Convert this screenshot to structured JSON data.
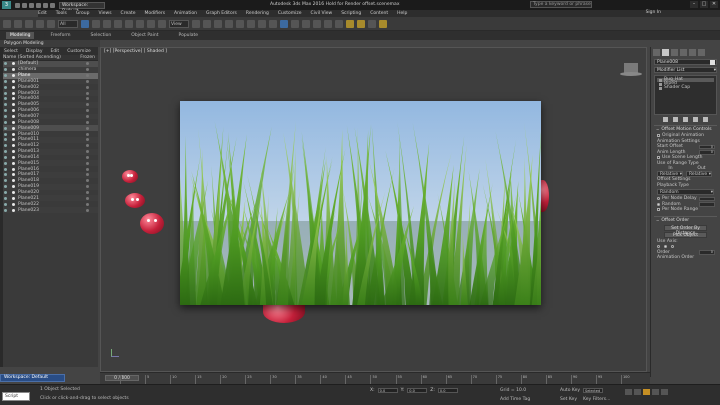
{
  "titlebar": {
    "workspace": "Workspace: Default",
    "title": "Autodesk 3ds Max 2016  Hold for Render  offset.scenemax",
    "search_placeholder": "Type a keyword or phrase",
    "signin": "Sign In"
  },
  "menu": [
    "Edit",
    "Tools",
    "Group",
    "Views",
    "Create",
    "Modifiers",
    "Animation",
    "Graph Editors",
    "Rendering",
    "Customize",
    "Civil View",
    "Scripting",
    "Content",
    "Help"
  ],
  "toolbar": {
    "selection_filter": "All",
    "view_drop": "View"
  },
  "ribbon": {
    "tabs": [
      "Modeling",
      "Freeform",
      "Selection",
      "Object Paint",
      "Populate"
    ],
    "active_tab": "Modeling",
    "subpanel": "Polygon Modeling"
  },
  "scene_explorer": {
    "menu": [
      "Select",
      "Display",
      "Edit",
      "Customize"
    ],
    "columns": [
      "Name (Sorted Ascending)",
      "Frozen"
    ],
    "items": [
      {
        "name": "[Default]",
        "state": "hl"
      },
      {
        "name": "chimera",
        "state": ""
      },
      {
        "name": "Plane",
        "state": "sel"
      },
      {
        "name": "Plane001",
        "state": ""
      },
      {
        "name": "Plane002",
        "state": ""
      },
      {
        "name": "Plane003",
        "state": ""
      },
      {
        "name": "Plane004",
        "state": ""
      },
      {
        "name": "Plane005",
        "state": ""
      },
      {
        "name": "Plane006",
        "state": ""
      },
      {
        "name": "Plane007",
        "state": ""
      },
      {
        "name": "Plane008",
        "state": ""
      },
      {
        "name": "Plane009",
        "state": "hl"
      },
      {
        "name": "Plane010",
        "state": ""
      },
      {
        "name": "Plane011",
        "state": ""
      },
      {
        "name": "Plane012",
        "state": ""
      },
      {
        "name": "Plane013",
        "state": ""
      },
      {
        "name": "Plane014",
        "state": ""
      },
      {
        "name": "Plane015",
        "state": ""
      },
      {
        "name": "Plane016",
        "state": ""
      },
      {
        "name": "Plane017",
        "state": ""
      },
      {
        "name": "Plane018",
        "state": ""
      },
      {
        "name": "Plane019",
        "state": ""
      },
      {
        "name": "Plane020",
        "state": ""
      },
      {
        "name": "Plane021",
        "state": ""
      },
      {
        "name": "Plane022",
        "state": ""
      },
      {
        "name": "Plane023",
        "state": ""
      }
    ]
  },
  "viewport": {
    "label": "[+] [Perspective] [ Shaded ]"
  },
  "command_panel": {
    "object_name": "Plane008",
    "modifier_list": "Modifier List",
    "stack": [
      "Bug_Hat",
      "Biped",
      "Shader Cap"
    ],
    "rollout_offset": "Offset Motion Controls",
    "original_animation": "Original Animation",
    "animation_settings": "Animation Settings",
    "start_offset_label": "Start Offset",
    "start_offset": "0",
    "anim_length_label": "Anim Length",
    "anim_length": "0",
    "use_scene_length": "Use Scene Length",
    "use_range": "Use of Range Type",
    "col1": "In",
    "col2": "Out",
    "range_in": "Relative",
    "range_out": "Relative",
    "offset_settings": "Offset Settings",
    "playback_type": "Playback Type",
    "playback_value": "Random",
    "per_node_delay": "Per Node Delay",
    "random": "Random",
    "per_node_range": "Per Node Range",
    "offset_order": "Offset Order",
    "set_order_btn": "Set Order By Distance",
    "pick_object_btn": "Pick Object",
    "use_axis": "Use Axis:",
    "order_label": "Order",
    "order_value": "0",
    "animation_order": "Animation Order"
  },
  "timeline": {
    "slider": "0 / 100",
    "ticks": [
      "0",
      "5",
      "10",
      "15",
      "20",
      "25",
      "30",
      "35",
      "40",
      "45",
      "50",
      "55",
      "60",
      "65",
      "70",
      "75",
      "80",
      "85",
      "90",
      "95",
      "100"
    ]
  },
  "bottom": {
    "workspace": "Workspace: Default",
    "maxscript": "Script",
    "status1": "1 Object Selected",
    "status2": "Click or click-and-drag to select objects",
    "x_label": "X:",
    "x_value": "0.0",
    "y_label": "Y:",
    "y_value": "0.0",
    "z_label": "Z:",
    "z_value": "0.0",
    "grid": "Grid = 10.0",
    "autokey": "Auto Key",
    "selected": "Selected",
    "setkey": "Set Key",
    "keyfilters": "Key Filters...",
    "add_time_tag": "Add Time Tag"
  }
}
